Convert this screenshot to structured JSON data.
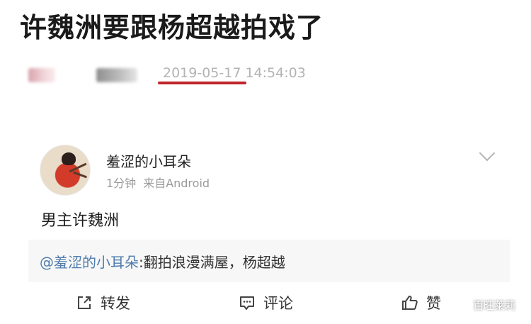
{
  "headline": "许魏洲要跟杨超越拍戏了",
  "meta": {
    "timestamp": "2019-05-17 14:54:03"
  },
  "post": {
    "username": "羞涩的小耳朵",
    "time_ago": "1分钟",
    "source": "来自Android",
    "text": "男主许魏洲",
    "quote": {
      "mention": "@羞涩的小耳朵",
      "text": ":翻拍浪漫满屋，杨超越"
    },
    "actions": {
      "forward": "转发",
      "comment": "评论",
      "like": "赞"
    }
  },
  "watermark": "百旺莱莉",
  "colors": {
    "underline": "#c0252b",
    "mention": "#4f7cad",
    "meta_gray": "#999999"
  },
  "icons": [
    "chevron-down-icon",
    "forward-icon",
    "comment-icon",
    "thumbs-up-icon",
    "wechat-icon"
  ]
}
